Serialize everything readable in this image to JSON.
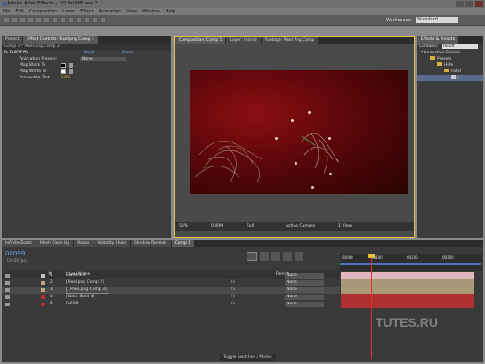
{
  "window": {
    "title": "Adobe After Effects - 3D FallOff.aep *"
  },
  "menu": [
    "File",
    "Edit",
    "Composition",
    "Layer",
    "Effect",
    "Animation",
    "View",
    "Window",
    "Help"
  ],
  "workspace": {
    "label": "Workspace:",
    "value": "Standard"
  },
  "project_panel": {
    "tabs": [
      "Project",
      "Effect Controls: Pixel.png Comp 1"
    ],
    "breadcrumb": "Comp 1 * Pixel.png Comp 2",
    "effect": {
      "name": "fx FallOff.ffx",
      "reset": "Reset",
      "about": "About..."
    },
    "animation_presets": {
      "label": "Animation Presets:",
      "value": "None"
    },
    "params": [
      {
        "label": "Map Black To",
        "value": ""
      },
      {
        "label": "Map White To",
        "value": ""
      },
      {
        "label": "Amount to Tint",
        "value": "0.0%"
      }
    ]
  },
  "viewer_panel": {
    "tabs": [
      "Composition: Comp 1",
      "Layer: (none)",
      "Footage: Pixel.Png Comp"
    ],
    "footer": {
      "zoom": "53%",
      "timecode": "00099",
      "resolution": "Full",
      "camera": "Active Camera",
      "views": "1 View"
    }
  },
  "effects_panel": {
    "tabs": [
      "Effects & Presets"
    ],
    "search_label": "Contains:",
    "search_value": "falloff",
    "tree": [
      "* Animation Presets",
      "Presets",
      "Hide",
      "FallO",
      "f"
    ]
  },
  "timeline": {
    "tabs": [
      "Infinite Zoom",
      "Mesh Close Up",
      "Rocks",
      "Visibility Chart",
      "Shadow Reveals",
      "Comp 1"
    ],
    "timecode": "00099",
    "fps": "(29.00 fps)",
    "headers": {
      "num": "#",
      "source": "Layer Name",
      "parent": "Parent"
    },
    "ruler": [
      "00000",
      "00100",
      "00200",
      "00300"
    ],
    "layers": [
      {
        "num": "1",
        "name": "Camera 1",
        "parent": "None",
        "color": "#c0c0c0",
        "bar": "#e0b8c0"
      },
      {
        "num": "2",
        "name": "[Pixel.png Comp 2]",
        "parent": "None",
        "color": "#b9a681",
        "bar": "#a89a78"
      },
      {
        "num": "3",
        "name": "[Pixel.png Comp 3]",
        "parent": "None",
        "color": "#b9a681",
        "bar": "#a89a78"
      },
      {
        "num": "4",
        "name": "[Black Solid 4]",
        "parent": "None",
        "color": "#b03030",
        "bar": "#b03030"
      },
      {
        "num": "5",
        "name": "FallOff",
        "parent": "None",
        "color": "#b03030",
        "bar": "#b03030"
      }
    ],
    "footer": "Toggle Switches / Modes"
  },
  "watermark": "TUTES.RU",
  "colors": {
    "accent": "#e8c040",
    "comp_bg": "#7a0a0c",
    "playhead": "#e03030"
  }
}
